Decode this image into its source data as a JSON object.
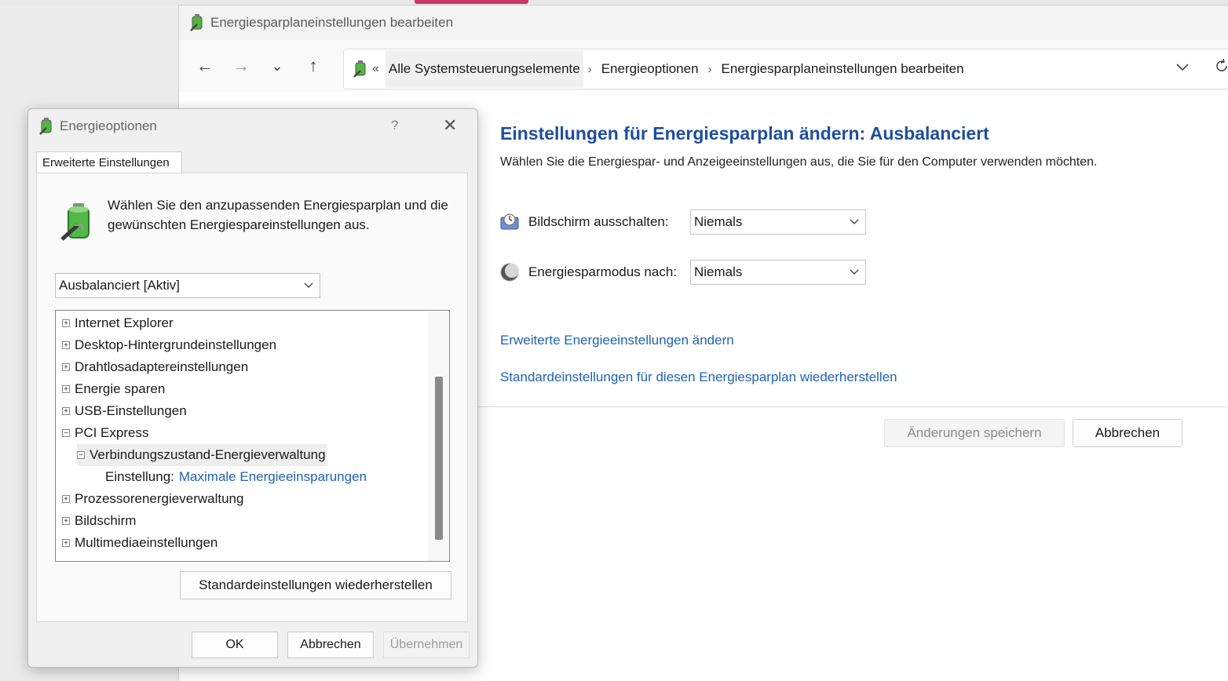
{
  "control_panel": {
    "window_title": "Energiesparplaneinstellungen bearbeiten",
    "nav": {
      "back": "←",
      "forward": "→",
      "recent": "⌄",
      "up": "↑"
    },
    "breadcrumb": {
      "overflow": "«",
      "items": [
        "Alle Systemsteuerungselemente",
        "Energieoptionen",
        "Energiesparplaneinstellungen bearbeiten"
      ],
      "separator": "›"
    },
    "heading": "Einstellungen für Energiesparplan ändern: Ausbalanciert",
    "description": "Wählen Sie die Energiespar- und Anzeigeeinstellungen aus, die Sie für den Computer verwenden möchten.",
    "settings": [
      {
        "label": "Bildschirm ausschalten:",
        "value": "Niemals",
        "icon": "monitor-clock-icon"
      },
      {
        "label": "Energiesparmodus nach:",
        "value": "Niemals",
        "icon": "moon-icon"
      }
    ],
    "links": {
      "advanced": "Erweiterte Energieeinstellungen ändern",
      "restore_defaults": "Standardeinstellungen für diesen Energiesparplan wiederherstellen"
    },
    "buttons": {
      "save": "Änderungen speichern",
      "cancel": "Abbrechen"
    }
  },
  "dialog": {
    "title": "Energieoptionen",
    "help": "?",
    "close": "✕",
    "tab": "Erweiterte Einstellungen",
    "intro": "Wählen Sie den anzupassenden Energiesparplan und die gewünschten Energiespareinstellungen aus.",
    "plan": "Ausbalanciert [Aktiv]",
    "tree": {
      "items": [
        {
          "label": "Internet Explorer",
          "state": "+"
        },
        {
          "label": "Desktop-Hintergrundeinstellungen",
          "state": "+"
        },
        {
          "label": "Drahtlosadaptereinstellungen",
          "state": "+"
        },
        {
          "label": "Energie sparen",
          "state": "+"
        },
        {
          "label": "USB-Einstellungen",
          "state": "+"
        },
        {
          "label": "PCI Express",
          "state": "−"
        },
        {
          "label": "Verbindungszustand-Energieverwaltung",
          "state": "−"
        },
        {
          "label": "Einstellung:",
          "value": "Maximale Energieeinsparungen"
        },
        {
          "label": "Prozessorenergieverwaltung",
          "state": "+"
        },
        {
          "label": "Bildschirm",
          "state": "+"
        },
        {
          "label": "Multimediaeinstellungen",
          "state": "+"
        }
      ]
    },
    "restore_button": "Standardeinstellungen wiederherstellen",
    "buttons": {
      "ok": "OK",
      "cancel": "Abbrechen",
      "apply": "Übernehmen"
    }
  },
  "colors": {
    "heading": "#1e4e9e",
    "link": "#1e63b6",
    "taskbar_accent": "#c8396a"
  }
}
